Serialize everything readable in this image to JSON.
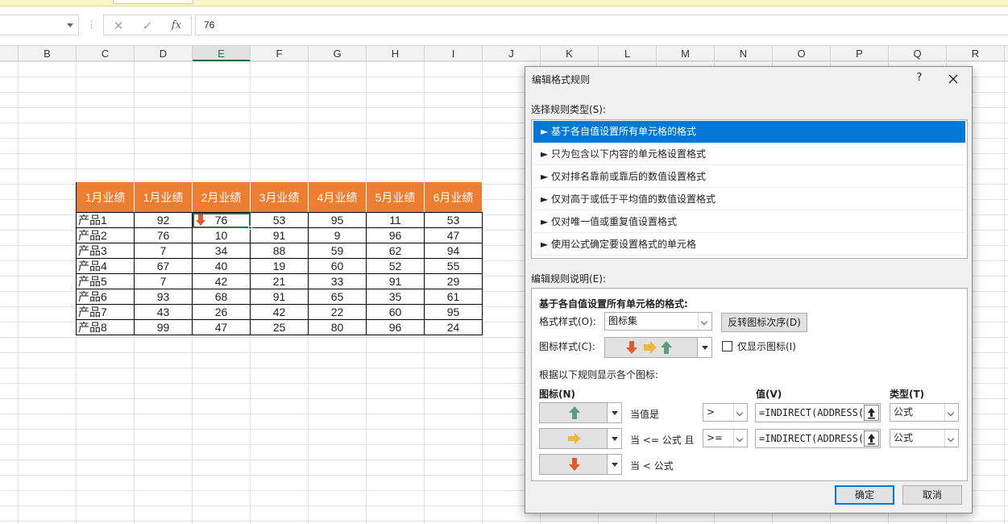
{
  "formula_bar": {
    "cancel_glyph": "✕",
    "enter_glyph": "✓",
    "fx_label": "fx",
    "value": "76"
  },
  "columns": [
    "B",
    "C",
    "D",
    "E",
    "F",
    "G",
    "H",
    "I",
    "J",
    "K",
    "L",
    "M",
    "N",
    "O",
    "P",
    "Q",
    "R"
  ],
  "selected_column": "E",
  "table": {
    "headers": [
      "1月业绩",
      "1月业绩",
      "2月业绩",
      "3月业绩",
      "4月业绩",
      "5月业绩",
      "6月业绩"
    ],
    "rows": [
      [
        "产品1",
        "92",
        "76",
        "53",
        "95",
        "11",
        "53"
      ],
      [
        "产品2",
        "76",
        "10",
        "91",
        "9",
        "96",
        "47"
      ],
      [
        "产品3",
        "7",
        "34",
        "88",
        "59",
        "62",
        "94"
      ],
      [
        "产品4",
        "67",
        "40",
        "19",
        "60",
        "52",
        "55"
      ],
      [
        "产品5",
        "7",
        "42",
        "21",
        "33",
        "91",
        "29"
      ],
      [
        "产品6",
        "93",
        "68",
        "91",
        "65",
        "35",
        "61"
      ],
      [
        "产品7",
        "43",
        "26",
        "42",
        "22",
        "60",
        "95"
      ],
      [
        "产品8",
        "99",
        "47",
        "25",
        "80",
        "96",
        "24"
      ]
    ],
    "header_color": "#ed7d31"
  },
  "dialog": {
    "title": "编辑格式规则",
    "help": "?",
    "select_rule_type_label": "选择规则类型(S):",
    "rule_types": [
      "► 基于各自值设置所有单元格的格式",
      "► 只为包含以下内容的单元格设置格式",
      "► 仅对排名靠前或靠后的数值设置格式",
      "► 仅对高于或低于平均值的数值设置格式",
      "► 仅对唯一值或重复值设置格式",
      "► 使用公式确定要设置格式的单元格"
    ],
    "edit_rule_desc_label": "编辑规则说明(E):",
    "desc_heading": "基于各自值设置所有单元格的格式:",
    "format_style_label": "格式样式(O):",
    "format_style_value": "图标集",
    "reverse_icon_order": "反转图标次序(D)",
    "icon_style_label": "图标样式(C):",
    "show_icon_only": "仅显示图标(I)",
    "rule_intro": "根据以下规则显示各个图标:",
    "col_icon": "图标(N)",
    "col_value": "值(V)",
    "col_type": "类型(T)",
    "rules": [
      {
        "icon": "green-up-arrow",
        "text": "当值是",
        "op": ">",
        "value": "=INDIRECT(ADDRESS(",
        "type": "公式"
      },
      {
        "icon": "yellow-right-arrow",
        "text": "当 <= 公式 且",
        "op": ">=",
        "value": "=INDIRECT(ADDRESS(",
        "type": "公式"
      },
      {
        "icon": "red-down-arrow",
        "text": "当 < 公式"
      }
    ],
    "ok": "确定",
    "cancel": "取消",
    "colors": {
      "up": "#5e9e7e",
      "right": "#f0b740",
      "down": "#e05a2b",
      "accent": "#0078d7"
    }
  }
}
